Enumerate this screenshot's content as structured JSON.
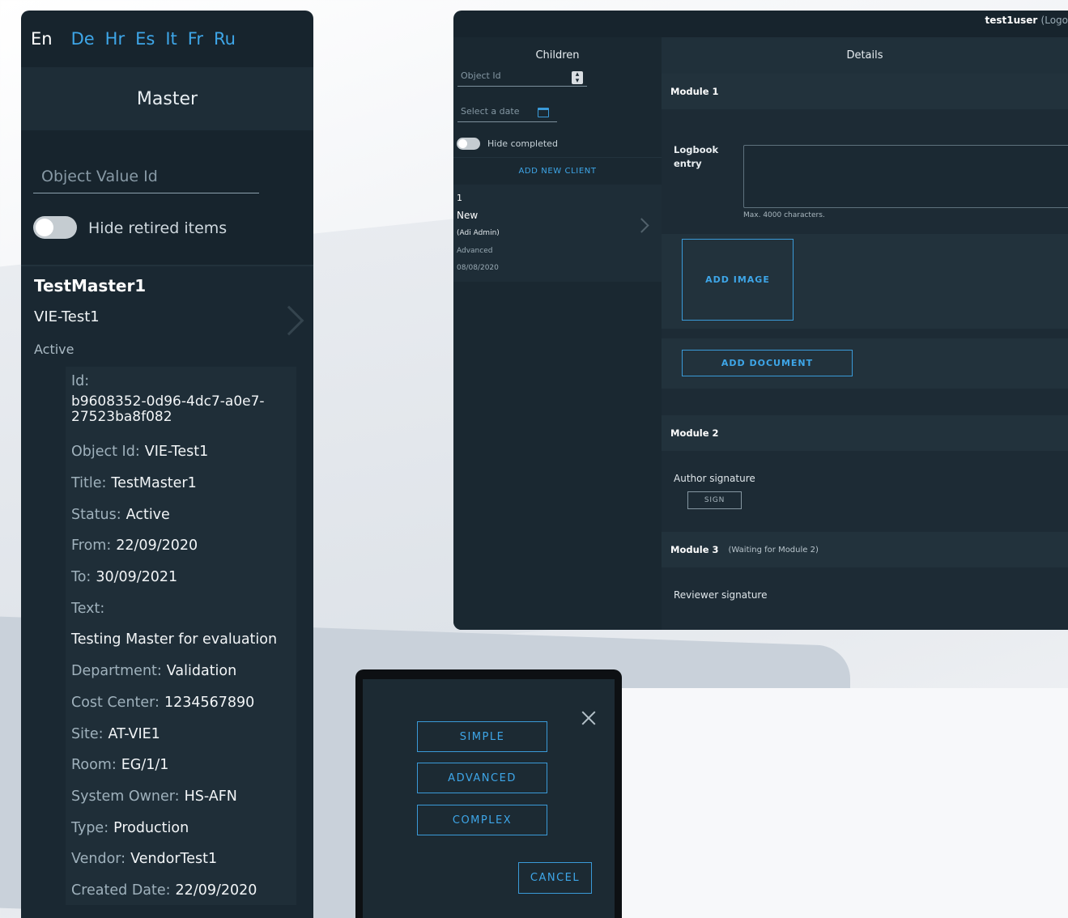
{
  "languages": [
    {
      "code": "En",
      "active": true
    },
    {
      "code": "De",
      "active": false
    },
    {
      "code": "Hr",
      "active": false
    },
    {
      "code": "Es",
      "active": false
    },
    {
      "code": "It",
      "active": false
    },
    {
      "code": "Fr",
      "active": false
    },
    {
      "code": "Ru",
      "active": false
    }
  ],
  "master": {
    "title": "Master",
    "search_placeholder": "Object Value Id",
    "hide_retired_label": "Hide retired items",
    "item": {
      "title": "TestMaster1",
      "object_id": "VIE-Test1",
      "status": "Active",
      "id_label": "Id:",
      "id_value": "b9608352-0d96-4dc7-a0e7-27523ba8f082",
      "details": [
        {
          "label": "Object Id:",
          "value": "VIE-Test1"
        },
        {
          "label": "Title:",
          "value": "TestMaster1"
        },
        {
          "label": "Status:",
          "value": "Active"
        },
        {
          "label": "From:",
          "value": "22/09/2020"
        },
        {
          "label": "To:",
          "value": "30/09/2021"
        },
        {
          "label": "Text:",
          "value": ""
        },
        {
          "label": "",
          "value": "Testing Master for evaluation"
        },
        {
          "label": "Department:",
          "value": "Validation"
        },
        {
          "label": "Cost Center:",
          "value": "1234567890"
        },
        {
          "label": "Site:",
          "value": "AT-VIE1"
        },
        {
          "label": "Room:",
          "value": "EG/1/1"
        },
        {
          "label": "System Owner:",
          "value": "HS-AFN"
        },
        {
          "label": "Type:",
          "value": "Production"
        },
        {
          "label": "Vendor:",
          "value": "VendorTest1"
        },
        {
          "label": "Created Date:",
          "value": "22/09/2020"
        }
      ]
    }
  },
  "logbook": {
    "user": "test1user",
    "logout": "(Logo",
    "children_header": "Children",
    "details_header": "Details",
    "object_id_placeholder": "Object Id",
    "date_placeholder": "Select a date",
    "hide_completed_label": "Hide completed",
    "add_client_label": "ADD NEW CLIENT",
    "client": {
      "number": "1",
      "status": "New",
      "user": "(Adi Admin)",
      "type": "Advanced",
      "date": "08/08/2020"
    },
    "module1_title": "Module 1",
    "logbook_entry_label": "Logbook entry",
    "max_chars": "Max. 4000 characters.",
    "add_image_label": "ADD IMAGE",
    "add_document_label": "ADD DOCUMENT",
    "module2_title": "Module 2",
    "author_signature_label": "Author signature",
    "sign_label": "SIGN",
    "module3_title": "Module 3",
    "module3_waiting": "(Waiting for Module 2)",
    "reviewer_signature_label": "Reviewer signature"
  },
  "dialog": {
    "options": [
      "SIMPLE",
      "ADVANCED",
      "COMPLEX"
    ],
    "cancel_label": "CANCEL"
  }
}
